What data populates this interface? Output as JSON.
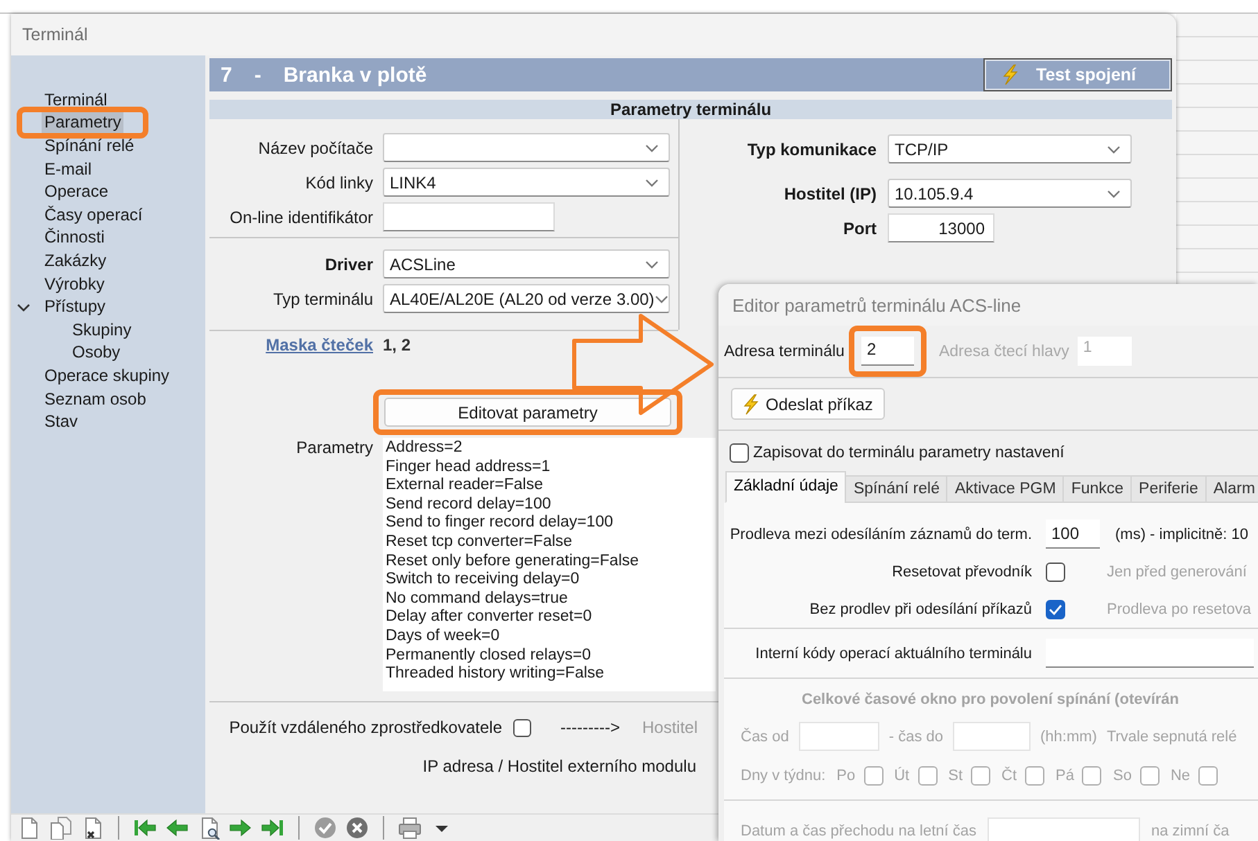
{
  "window": {
    "title": "Terminál"
  },
  "sidebar": {
    "items": [
      {
        "label": "Terminál",
        "selected": false,
        "highlighted": false
      },
      {
        "label": "Parametry",
        "selected": true,
        "highlighted": true
      },
      {
        "label": "Spínání relé",
        "selected": false,
        "highlighted": false
      },
      {
        "label": "E-mail",
        "selected": false,
        "highlighted": false
      },
      {
        "label": "Operace",
        "selected": false,
        "highlighted": false
      },
      {
        "label": "Časy operací",
        "selected": false,
        "highlighted": false
      },
      {
        "label": "Činnosti",
        "selected": false,
        "highlighted": false
      },
      {
        "label": "Zakázky",
        "selected": false,
        "highlighted": false
      },
      {
        "label": "Výrobky",
        "selected": false,
        "highlighted": false
      },
      {
        "label": "Přístupy",
        "selected": false,
        "highlighted": false,
        "expanded": true,
        "children": [
          {
            "label": "Skupiny",
            "selected": false
          },
          {
            "label": "Osoby",
            "selected": false
          }
        ]
      },
      {
        "label": "Operace skupiny",
        "selected": false,
        "highlighted": false
      },
      {
        "label": "Seznam osob",
        "selected": false,
        "highlighted": false
      },
      {
        "label": "Stav",
        "selected": false,
        "highlighted": false
      }
    ]
  },
  "header": {
    "number": "7",
    "separator": "-",
    "title": "Branka v plotě",
    "test_button": "Test spojení"
  },
  "section_title": "Parametry terminálu",
  "left_groups": [
    [
      {
        "kind": "select",
        "label": "Název počítače",
        "strong": false
      },
      {
        "kind": "select",
        "label": "Kód linky",
        "value": "LINK4",
        "strong": false
      },
      {
        "kind": "input",
        "label": "On-line identifikátor",
        "strong": false
      }
    ],
    [
      {
        "kind": "select",
        "label": "Driver",
        "value": "ACSLine",
        "strong": true
      },
      {
        "kind": "select",
        "label": "Typ terminálu",
        "value": "AL40E/AL20E (AL20 od verze 3.00)",
        "strong": false
      }
    ]
  ],
  "right_fields": [
    {
      "kind": "select",
      "label": "Typ komunikace",
      "value": "TCP/IP",
      "strong": true
    },
    {
      "kind": "select",
      "label": "Hostitel (IP)",
      "value": "10.105.9.4",
      "strong": true
    },
    {
      "kind": "number",
      "label": "Port",
      "value": "13000",
      "strong": true
    }
  ],
  "mask": {
    "link": "Maska čteček",
    "value": "1, 2"
  },
  "edit_button": {
    "label": "Editovat parametry",
    "highlighted": true
  },
  "parameters": {
    "label": "Parametry",
    "lines": [
      "Address=2",
      "Finger head address=1",
      "External reader=False",
      "Send record delay=100",
      "Send to finger record delay=100",
      "Reset tcp converter=False",
      "Reset only before generating=False",
      "Switch to receiving delay=0",
      "No command delays=true",
      "Delay after converter reset=0",
      "Days of week=0",
      "Permanently closed relays=0",
      "Threaded history writing=False"
    ]
  },
  "remote": {
    "label": "Použít vzdáleného zprostředkovatele",
    "checked": false,
    "arrow": "--------->",
    "host_label": "Hostitel",
    "module_label": "IP adresa / Hostitel externího modulu"
  },
  "toolbar": [
    [
      {
        "kind": "new",
        "disabled": false
      },
      {
        "kind": "copy",
        "disabled": false
      },
      {
        "kind": "delete",
        "disabled": false
      }
    ],
    [
      {
        "kind": "first",
        "disabled": false
      },
      {
        "kind": "previous",
        "disabled": false
      },
      {
        "kind": "find",
        "disabled": false
      },
      {
        "kind": "next",
        "disabled": false
      },
      {
        "kind": "last",
        "disabled": false
      }
    ],
    [
      {
        "kind": "confirm",
        "disabled": true
      },
      {
        "kind": "cancel",
        "disabled": true
      }
    ],
    [
      {
        "kind": "print",
        "disabled": false
      },
      {
        "kind": "dropdown",
        "disabled": false
      }
    ]
  ],
  "dialog": {
    "title": "Editor parametrů terminálu ACS-line",
    "address": {
      "label": "Adresa terminálu",
      "value": "2",
      "highlighted": true
    },
    "head_address": {
      "label": "Adresa čtecí hlavy",
      "value": "1",
      "disabled": true
    },
    "send_button": "Odeslat příkaz",
    "write_settings": {
      "label": "Zapisovat do terminálu parametry nastavení",
      "checked": false
    },
    "tabs": [
      {
        "label": "Základní údaje",
        "selected": true
      },
      {
        "label": "Spínání relé",
        "selected": false
      },
      {
        "label": "Aktivace PGM",
        "selected": false
      },
      {
        "label": "Funkce",
        "selected": false
      },
      {
        "label": "Periferie",
        "selected": false
      },
      {
        "label": "Alarm",
        "selected": false
      }
    ],
    "rows": [
      {
        "kind": "input",
        "label": "Prodleva mezi odesíláním záznamů do term.",
        "value": "100",
        "note": "(ms) - implicitně: 10",
        "note_disabled": false
      },
      {
        "kind": "checkbox",
        "label": "Resetovat převodník",
        "checked": false,
        "note": "Jen před generování",
        "note_disabled": true
      },
      {
        "kind": "checkbox",
        "label": "Bez prodlev při odesílání příkazů",
        "checked": true,
        "note": "Prodleva po resetova",
        "note_disabled": true
      },
      {
        "kind": "divider"
      },
      {
        "kind": "wide_input",
        "label": "Interní kódy operací aktuálního terminálu"
      },
      {
        "kind": "divider"
      },
      {
        "kind": "heading",
        "label": "Celkové časové okno pro povolení spínání (otevírán",
        "disabled": true
      },
      {
        "kind": "time",
        "from_label": "Čas od",
        "to_label": "- čas do",
        "format": "(hh:mm)",
        "note": "Trvale sepnutá relé",
        "disabled": true
      },
      {
        "kind": "days",
        "label": "Dny v týdnu:",
        "disabled": true,
        "days": [
          {
            "label": "Po",
            "checked": false
          },
          {
            "label": "Út",
            "checked": false
          },
          {
            "label": "St",
            "checked": false
          },
          {
            "label": "Čt",
            "checked": false
          },
          {
            "label": "Pá",
            "checked": false
          },
          {
            "label": "So",
            "checked": false
          },
          {
            "label": "Ne",
            "checked": false
          }
        ]
      },
      {
        "kind": "divider"
      },
      {
        "kind": "date",
        "label": "Datum a čas přechodu na letní čas",
        "note": "na zimní ča",
        "disabled": true
      }
    ]
  }
}
